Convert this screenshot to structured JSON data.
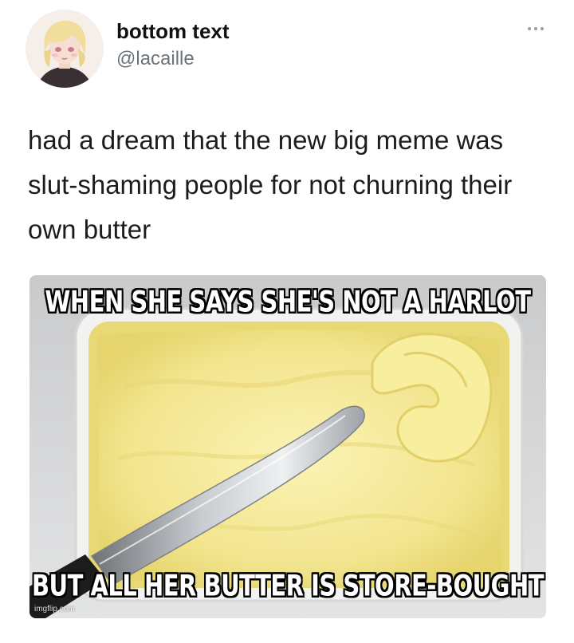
{
  "tweet": {
    "display_name": "bottom text",
    "handle": "@lacaille",
    "text": "had a dream that the new big meme was slut-shaming people for not churning their own butter",
    "more_icon": "more-horizontal-icon"
  },
  "meme": {
    "top_caption": "WHEN SHE SAYS SHE'S NOT A HARLOT",
    "bottom_caption": "BUT ALL HER BUTTER IS STORE-BOUGHT",
    "watermark": "imgflip.com",
    "colors": {
      "butter": "#f3e89a",
      "tub": "#e8e9ea",
      "blade": "#b9bcc0"
    }
  }
}
